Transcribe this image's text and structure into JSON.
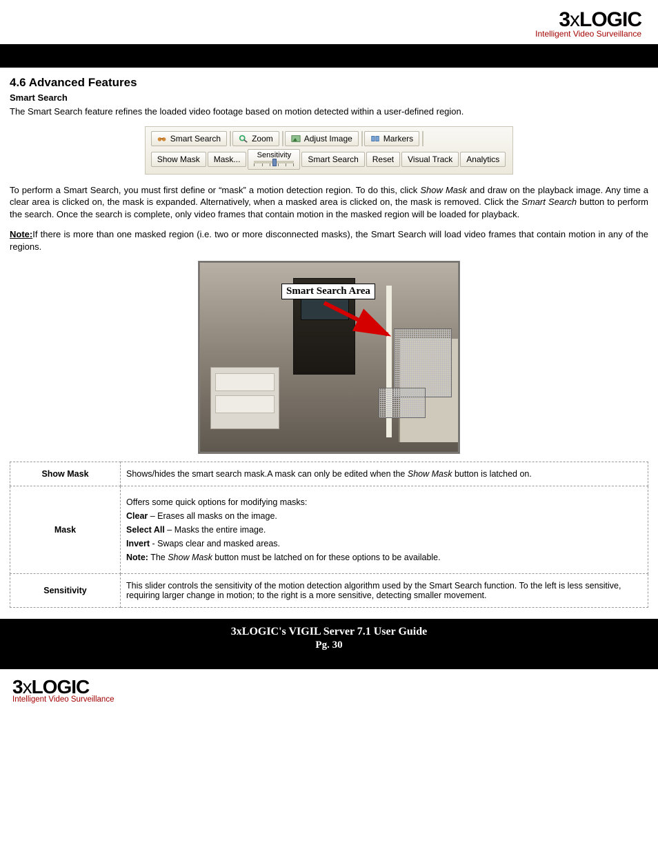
{
  "brand": {
    "name_html": "3xLOGIC",
    "three": "3",
    "x": "x",
    "logic": "LOGIC",
    "tagline": "Intelligent Video Surveillance"
  },
  "section": {
    "heading": "4.6 Advanced Features",
    "sub": "Smart Search"
  },
  "para1": "The Smart Search feature refines the loaded video footage based on motion detected within a user-defined region.",
  "toolbar": {
    "row1": {
      "smart_search_tab": "Smart Search",
      "zoom_tab": "Zoom",
      "adjust_tab": "Adjust Image",
      "markers_tab": "Markers"
    },
    "row2": {
      "show_mask": "Show Mask",
      "mask": "Mask...",
      "sensitivity": "Sensitivity",
      "smart_search": "Smart Search",
      "reset": "Reset",
      "visual_track": "Visual Track",
      "analytics": "Analytics"
    }
  },
  "para2_a": "To perform a Smart Search, you must first define or “mask” a motion detection region. To do this, click ",
  "para2_b_ital": "Show Mask",
  "para2_c": " and draw on the playback image. Any time a clear area is clicked on, the mask is expanded. Alternatively, when a masked area is clicked on, the mask is removed. Click the ",
  "para2_d_ital": "Smart Search",
  "para2_e": " button to perform the search. Once the search is complete, only video frames that contain motion in the masked region will be loaded for playback.",
  "note_label": "Note:",
  "note_text": "If there is more than one masked region (i.e. two or more disconnected masks), the Smart Search will load video frames that contain motion in any of the regions.",
  "callout": "Smart Search Area",
  "table": {
    "rows": [
      {
        "key": "Show Mask",
        "plain_a": "Shows/hides the smart search mask.A mask can only be edited when the ",
        "ital": "Show Mask",
        "plain_b": " button is latched on."
      },
      {
        "key": "Mask",
        "intro": "Offers some quick options for modifying masks:",
        "opt1_b": "Clear",
        "opt1_t": " – Erases all masks on the image.",
        "opt2_b": "Select All",
        "opt2_t": " – Masks the entire image.",
        "opt3_b": "Invert",
        "opt3_t": " - Swaps clear and masked areas.",
        "note_b": "Note:",
        "note_pre": " The ",
        "note_ital": "Show Mask",
        "note_post": " button must be latched on for these options to be available."
      },
      {
        "key": "Sensitivity",
        "text": "This slider controls the sensitivity of the motion detection algorithm used by the Smart Search function. To the left is less sensitive, requiring larger change in motion; to the right is a more sensitive, detecting smaller movement."
      }
    ]
  },
  "footer": {
    "title": "3xLOGIC's VIGIL Server 7.1 User Guide",
    "page": "Pg. 30"
  }
}
